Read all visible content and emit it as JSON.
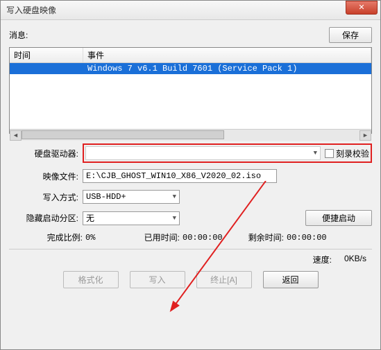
{
  "window": {
    "title": "写入硬盘映像"
  },
  "close_icon": "✕",
  "msg": {
    "label": "消息:",
    "save_btn": "保存"
  },
  "list": {
    "col_time": "时间",
    "col_event": "事件",
    "rows": [
      {
        "time": "",
        "event": "Windows 7 v6.1 Build 7601 (Service Pack 1)"
      }
    ]
  },
  "form": {
    "drive_label": "硬盘驱动器:",
    "drive_value": "",
    "verify_label": "刻录校验",
    "image_label": "映像文件:",
    "image_value": "E:\\CJB_GHOST_WIN10_X86_V2020_02.iso",
    "write_mode_label": "写入方式:",
    "write_mode_value": "USB-HDD+",
    "hide_boot_label": "隐藏启动分区:",
    "hide_boot_value": "无",
    "quick_boot_btn": "便捷启动"
  },
  "stats": {
    "done_ratio_label": "完成比例:",
    "done_ratio_value": "0%",
    "elapsed_label": "已用时间:",
    "elapsed_value": "00:00:00",
    "remain_label": "剩余时间:",
    "remain_value": "00:00:00",
    "speed_label": "速度:",
    "speed_value": "0KB/s"
  },
  "buttons": {
    "format": "格式化",
    "write": "写入",
    "stop": "终止[A]",
    "back": "返回"
  }
}
